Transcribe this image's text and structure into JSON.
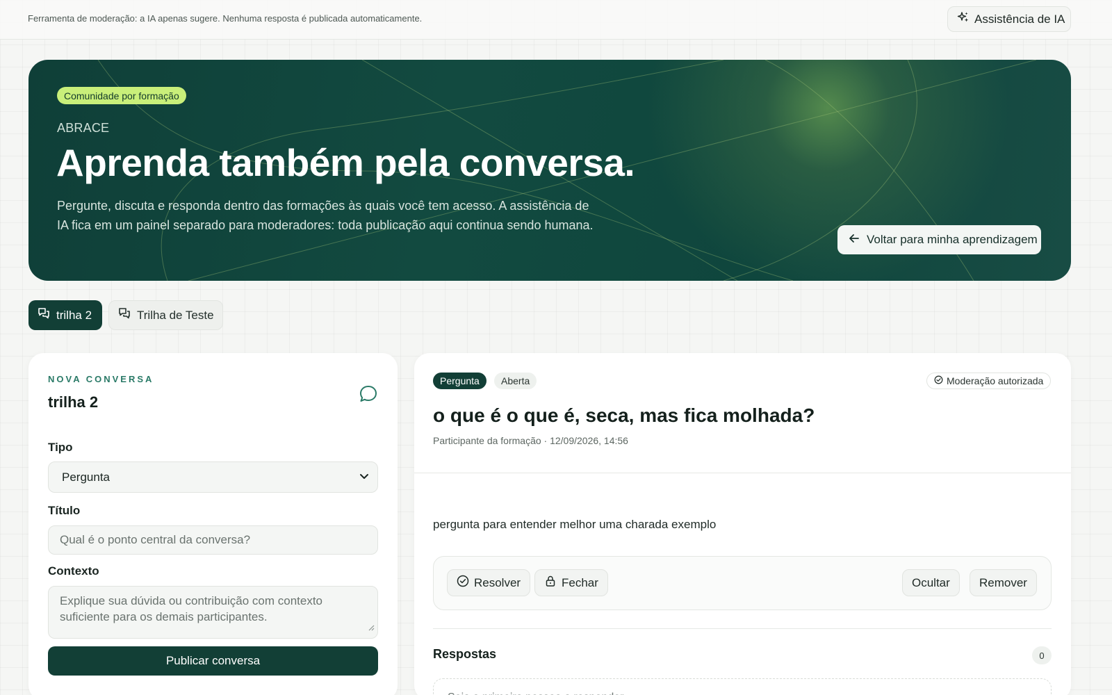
{
  "topbar": {
    "notice": "Ferramenta de moderação: a IA apenas sugere. Nenhuma resposta é publicada automaticamente.",
    "ai_button_label": "Assistência de IA",
    "ai_icon": "sparkles-icon"
  },
  "hero": {
    "badge": "Comunidade por formação",
    "eyebrow": "ABRACE",
    "title": "Aprenda também pela conversa.",
    "description": "Pergunte, discuta e responda dentro das formações às quais você tem acesso. A assistência de IA fica em um painel separado para moderadores: toda publicação aqui continua sendo humana.",
    "back_button": "Voltar para minha aprendizagem"
  },
  "tabs": [
    {
      "label": "trilha 2",
      "active": true,
      "icon": "chat-bubbles-icon"
    },
    {
      "label": "Trilha de Teste",
      "active": false,
      "icon": "chat-bubbles-icon"
    }
  ],
  "new_conversation": {
    "eyebrow": "NOVA CONVERSA",
    "title": "trilha 2",
    "type_label": "Tipo",
    "type_value": "Pergunta",
    "title_label": "Título",
    "title_placeholder": "Qual é o ponto central da conversa?",
    "context_label": "Contexto",
    "context_placeholder": "Explique sua dúvida ou contribuição com contexto suficiente para os demais participantes.",
    "publish_button": "Publicar conversa"
  },
  "thread": {
    "type_badge": "Pergunta",
    "status_badge": "Aberta",
    "moderation_badge": "Moderação autorizada",
    "title": "o que é o que é, seca, mas fica molhada?",
    "meta": "Participante da formação · 12/09/2026, 14:56",
    "body": "pergunta para entender melhor uma charada exemplo",
    "actions": {
      "resolve": "Resolver",
      "close": "Fechar",
      "hide": "Ocultar",
      "remove": "Remover"
    },
    "answers_title": "Respostas",
    "answers_count": "0",
    "empty_answers": "Seja a primeira pessoa a responder."
  },
  "colors": {
    "brand_dark": "#123f36",
    "accent_lime": "#c9ef7a",
    "eyebrow_teal": "#2a7a67"
  }
}
